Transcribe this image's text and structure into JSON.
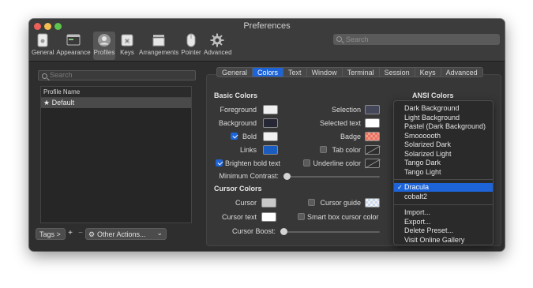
{
  "window": {
    "title": "Preferences"
  },
  "toolbar": {
    "items": [
      {
        "label": "General",
        "icon": "general-icon"
      },
      {
        "label": "Appearance",
        "icon": "appearance-icon"
      },
      {
        "label": "Profiles",
        "icon": "profiles-icon",
        "selected": true
      },
      {
        "label": "Keys",
        "icon": "keys-icon"
      },
      {
        "label": "Arrangements",
        "icon": "arrangements-icon"
      },
      {
        "label": "Pointer",
        "icon": "pointer-icon"
      },
      {
        "label": "Advanced",
        "icon": "gear-icon"
      }
    ],
    "search_placeholder": "Search"
  },
  "profiles": {
    "search_placeholder": "Search",
    "header": "Profile Name",
    "items": [
      {
        "label": "Default",
        "default_marker": "★"
      }
    ],
    "tags_button": "Tags >",
    "add": "+",
    "remove": "−",
    "other_actions": "Other Actions...",
    "other_actions_chevron": "⌄"
  },
  "tabs": [
    "General",
    "Colors",
    "Text",
    "Window",
    "Terminal",
    "Session",
    "Keys",
    "Advanced"
  ],
  "active_tab": "Colors",
  "basic_colors": {
    "title": "Basic Colors",
    "foreground": "Foreground",
    "background": "Background",
    "bold": "Bold",
    "links": "Links",
    "selection": "Selection",
    "selected_text": "Selected text",
    "badge": "Badge",
    "tab_color": "Tab color",
    "underline_color": "Underline color",
    "brighten_bold": "Brighten bold text",
    "minimum_contrast": "Minimum Contrast:"
  },
  "cursor_colors": {
    "title": "Cursor Colors",
    "cursor": "Cursor",
    "cursor_text": "Cursor text",
    "cursor_guide": "Cursor guide",
    "smart_box": "Smart box cursor color",
    "cursor_boost": "Cursor Boost:"
  },
  "swatch_colors": {
    "foreground": "#f0f0f0",
    "background": "#252734",
    "bold": "#f2f2f2",
    "links": "#1b5dbf",
    "selection": "#44475a",
    "selected_text": "#ffffff",
    "cursor": "#c8c8c8",
    "cursor_text": "#ffffff"
  },
  "checkboxes": {
    "bold": true,
    "brighten_bold": true,
    "tab_color": false,
    "underline_color": false,
    "cursor_guide": false,
    "smart_box": false
  },
  "ansi": {
    "title": "ANSI Colors",
    "presets_builtin": [
      "Dark Background",
      "Light Background",
      "Pastel (Dark Background)",
      "Smoooooth",
      "Solarized Dark",
      "Solarized Light",
      "Tango Dark",
      "Tango Light"
    ],
    "presets_custom": [
      "Dracula",
      "cobalt2"
    ],
    "selected_preset": "Dracula",
    "checkmark": "✓",
    "actions": [
      "Import...",
      "Export...",
      "Delete Preset...",
      "Visit Online Gallery"
    ]
  },
  "colors": {
    "accent": "#1c64d8",
    "window_bg": "#2e2e2e",
    "panel_bg": "#373737"
  }
}
